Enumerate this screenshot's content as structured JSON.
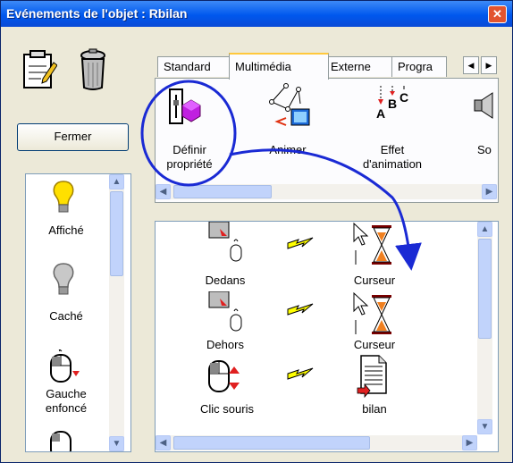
{
  "window": {
    "title": "Evénements de l'objet : Rbilan",
    "close": "✕"
  },
  "toolbar": {
    "notepad_icon": "notepad-pencil-icon",
    "trash_icon": "trash-can-icon",
    "close_label": "Fermer"
  },
  "tabs": [
    "Standard",
    "Multimédia",
    "Externe",
    "Progra"
  ],
  "tab_arrows": {
    "left": "◀",
    "right": "▶"
  },
  "actions": [
    {
      "line1": "Définir",
      "line2": "propriété",
      "icon": "cube-property-icon"
    },
    {
      "line1": "Animer",
      "line2": "",
      "icon": "animate-path-icon"
    },
    {
      "line1": "Effet",
      "line2": "d'animation",
      "icon": "animation-effect-icon"
    },
    {
      "line1": "So",
      "line2": "",
      "icon": "sound-icon"
    }
  ],
  "events": [
    {
      "label": "Affiché",
      "icon": "lightbulb-on-icon"
    },
    {
      "label": "Caché",
      "icon": "lightbulb-off-icon"
    },
    {
      "line1": "Gauche",
      "line2": "enfoncé",
      "icon": "mouse-down-icon"
    }
  ],
  "behaviors": [
    {
      "event": "Dedans",
      "action": "Curseur",
      "event_icon": "mouse-in-icon",
      "action_icon": "hourglass-cursor-icon"
    },
    {
      "event": "Dehors",
      "action": "Curseur",
      "event_icon": "mouse-out-icon",
      "action_icon": "hourglass-cursor-icon"
    },
    {
      "event": "Clic souris",
      "action": "bilan",
      "event_icon": "mouse-click-icon",
      "action_icon": "document-icon"
    }
  ],
  "colors": {
    "titlebar": "#0058ee",
    "highlight": "#1a2ad4",
    "panel_border": "#7f9db9"
  }
}
